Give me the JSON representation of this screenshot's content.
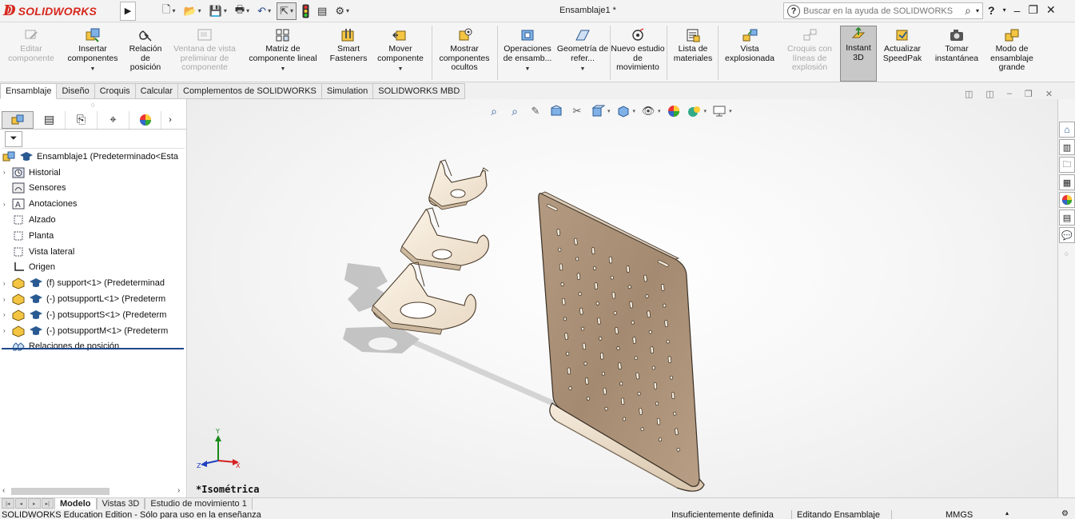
{
  "titlebar": {
    "brand_logo_text": "SOLIDWORKS",
    "window_title": "Ensamblaje1 *",
    "help_search_placeholder": "Buscar en la ayuda de SOLIDWORKS"
  },
  "commands": [
    {
      "label": "Editar componente",
      "disabled": true,
      "icon": "edit-component-icon"
    },
    {
      "label": "Insertar componentes",
      "disabled": false,
      "icon": "insert-components-icon",
      "dropdown": true
    },
    {
      "label": "Relación de posición",
      "disabled": false,
      "icon": "mate-icon"
    },
    {
      "label": "Ventana de vista preliminar de componente",
      "disabled": true,
      "icon": "preview-window-icon"
    },
    {
      "label": "Matriz de componente lineal",
      "disabled": false,
      "icon": "linear-pattern-icon",
      "dropdown": true
    },
    {
      "label": "Smart Fasteners",
      "disabled": false,
      "icon": "smart-fasteners-icon"
    },
    {
      "label": "Mover componente",
      "disabled": false,
      "icon": "move-component-icon",
      "dropdown": true
    },
    {
      "label": "Mostrar componentes ocultos",
      "disabled": false,
      "icon": "show-hidden-icon"
    },
    {
      "label": "Operaciones de ensamb...",
      "disabled": false,
      "icon": "assembly-features-icon",
      "dropdown": true
    },
    {
      "label": "Geometría de refer...",
      "disabled": false,
      "icon": "reference-geometry-icon",
      "dropdown": true
    },
    {
      "label": "Nuevo estudio de movimiento",
      "disabled": false,
      "icon": "motion-study-icon"
    },
    {
      "label": "Lista de materiales",
      "disabled": false,
      "icon": "bom-icon"
    },
    {
      "label": "Vista explosionada",
      "disabled": false,
      "icon": "exploded-view-icon"
    },
    {
      "label": "Croquis con líneas de explosión",
      "disabled": true,
      "icon": "explode-line-sketch-icon"
    },
    {
      "label": "Instant 3D",
      "disabled": false,
      "icon": "instant3d-icon",
      "active": true
    },
    {
      "label": "Actualizar SpeedPak",
      "disabled": false,
      "icon": "speedpak-icon"
    },
    {
      "label": "Tomar instantánea",
      "disabled": false,
      "icon": "snapshot-icon"
    },
    {
      "label": "Modo de ensamblaje grande",
      "disabled": false,
      "icon": "large-assembly-icon"
    }
  ],
  "tabs": [
    "Ensamblaje",
    "Diseño",
    "Croquis",
    "Calcular",
    "Complementos de SOLIDWORKS",
    "Simulation",
    "SOLIDWORKS MBD"
  ],
  "tree": {
    "root": "Ensamblaje1  (Predeterminado<Esta",
    "items": [
      {
        "label": "Historial",
        "expandable": true,
        "icon": "history-icon"
      },
      {
        "label": "Sensores",
        "expandable": false,
        "icon": "sensor-icon"
      },
      {
        "label": "Anotaciones",
        "expandable": true,
        "icon": "annotation-icon"
      },
      {
        "label": "Alzado",
        "expandable": false,
        "icon": "plane-icon"
      },
      {
        "label": "Planta",
        "expandable": false,
        "icon": "plane-icon"
      },
      {
        "label": "Vista lateral",
        "expandable": false,
        "icon": "plane-icon"
      },
      {
        "label": "Origen",
        "expandable": false,
        "icon": "origin-icon"
      },
      {
        "label": "(f) support<1>  (Predeterminad",
        "expandable": true,
        "icon": "part-icon"
      },
      {
        "label": "(-) potsupportL<1>  (Predeterm",
        "expandable": true,
        "icon": "part-icon"
      },
      {
        "label": "(-) potsupportS<1>  (Predeterm",
        "expandable": true,
        "icon": "part-icon"
      },
      {
        "label": "(-) potsupportM<1>  (Predeterm",
        "expandable": true,
        "icon": "part-icon"
      },
      {
        "label": "Relaciones de posición",
        "expandable": false,
        "icon": "mates-folder-icon"
      }
    ]
  },
  "viewport": {
    "view_name": "*Isométrica"
  },
  "bottom_tabs": [
    "Modelo",
    "Vistas 3D",
    "Estudio de movimiento 1"
  ],
  "status": {
    "edition": "SOLIDWORKS Education Edition - Sólo para uso en la enseñanza",
    "definition": "Insuficientemente definida",
    "mode": "Editando Ensamblaje",
    "units": "MMGS"
  },
  "colors": {
    "brand": "#d7281e",
    "board": "#a88d74",
    "part": "#f2e7d6"
  }
}
